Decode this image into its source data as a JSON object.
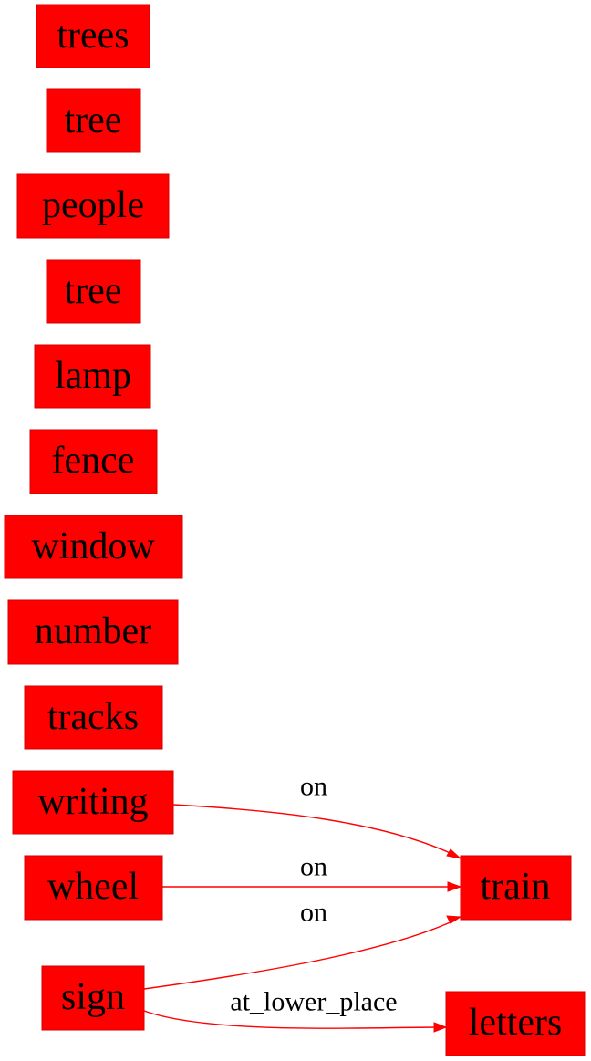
{
  "nodes": [
    {
      "id": "trees",
      "label": "trees"
    },
    {
      "id": "tree1",
      "label": "tree"
    },
    {
      "id": "people",
      "label": "people"
    },
    {
      "id": "tree2",
      "label": "tree"
    },
    {
      "id": "lamp",
      "label": "lamp"
    },
    {
      "id": "fence",
      "label": "fence"
    },
    {
      "id": "window",
      "label": "window"
    },
    {
      "id": "number",
      "label": "number"
    },
    {
      "id": "tracks",
      "label": "tracks"
    },
    {
      "id": "writing",
      "label": "writing"
    },
    {
      "id": "wheel",
      "label": "wheel"
    },
    {
      "id": "sign",
      "label": "sign"
    },
    {
      "id": "train",
      "label": "train"
    },
    {
      "id": "letters",
      "label": "letters"
    }
  ],
  "edges": [
    {
      "from": "writing",
      "to": "train",
      "label": "on"
    },
    {
      "from": "wheel",
      "to": "train",
      "label": "on"
    },
    {
      "from": "sign",
      "to": "train",
      "label": "on"
    },
    {
      "from": "sign",
      "to": "letters",
      "label": "at_lower_place"
    }
  ],
  "colors": {
    "node_fill": "#ff0000",
    "edge": "#ff0000",
    "text": "#000000"
  }
}
